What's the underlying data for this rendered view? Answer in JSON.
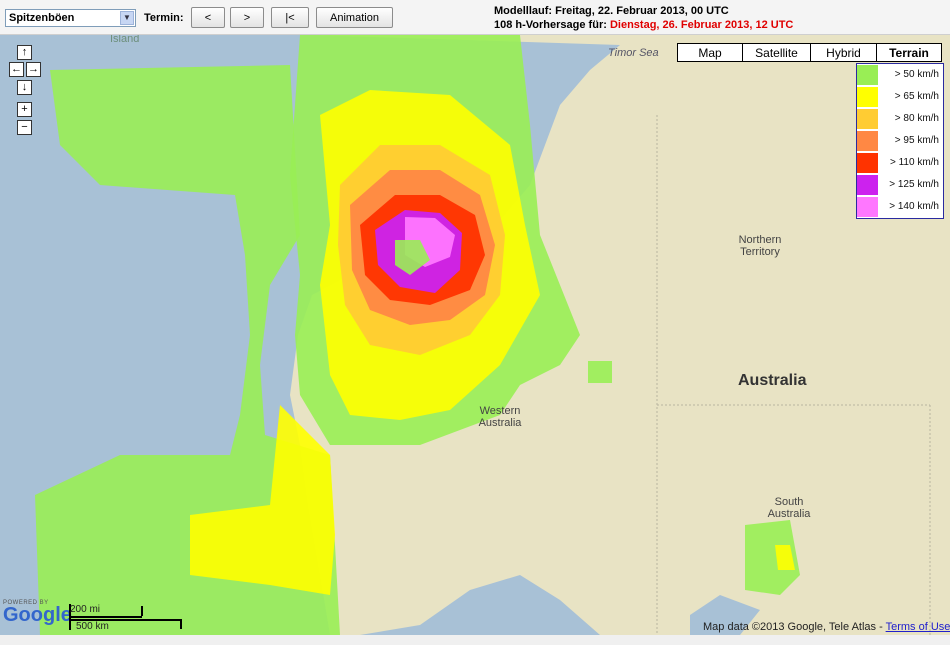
{
  "toolbar": {
    "parameter_select": "Spitzenböen",
    "termin_label": "Termin:",
    "prev_label": "<",
    "next_label": ">",
    "first_label": "|<",
    "animation_label": "Animation",
    "model_run": "Modelllauf: Freitag, 22. Februar 2013, 00 UTC",
    "forecast_prefix": "108 h-Vorhersage für:",
    "forecast_date": "Dienstag, 26. Februar 2013, 12 UTC"
  },
  "map_types": [
    {
      "label": "Map",
      "active": false
    },
    {
      "label": "Satellite",
      "active": false
    },
    {
      "label": "Hybrid",
      "active": false
    },
    {
      "label": "Terrain",
      "active": true
    }
  ],
  "legend": [
    {
      "label": "> 50 km/h",
      "color": "#99ee55"
    },
    {
      "label": "> 65 km/h",
      "color": "#ffff00"
    },
    {
      "label": "> 80 km/h",
      "color": "#ffcc33"
    },
    {
      "label": "> 95 km/h",
      "color": "#ff8844"
    },
    {
      "label": "> 110 km/h",
      "color": "#ff3300"
    },
    {
      "label": "> 125 km/h",
      "color": "#cc22ee"
    },
    {
      "label": "> 140 km/h",
      "color": "#ff77ff"
    }
  ],
  "map_labels": {
    "island": "Island",
    "timor_sea": "Timor Sea",
    "northern_territory": "Northern Territory",
    "australia": "Australia",
    "western_australia": "Western Australia",
    "south_australia": "South Australia"
  },
  "scale": {
    "miles": "200 mi",
    "km": "500 km"
  },
  "attribution": {
    "powered_by": "POWERED BY",
    "logo": "Google",
    "map_data": "Map data ©2013 Google, Tele Atlas -",
    "terms": "Terms of Use"
  },
  "colors": {
    "ocean": "#a8c1d6",
    "land": "#e8e3c4",
    "forecast_date": "#e00000"
  }
}
